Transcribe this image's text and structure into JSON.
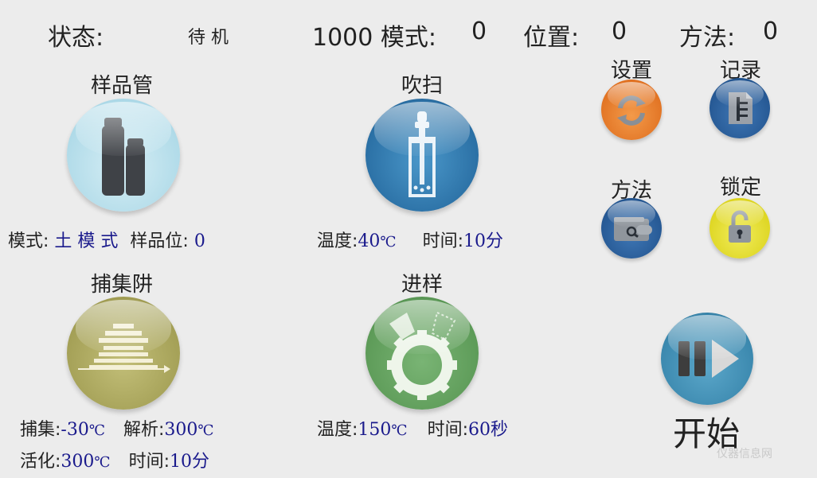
{
  "status_bar": {
    "state_label": "状态:",
    "state_value": "待 机",
    "mode_label": "1000 模式:",
    "mode_value": "0",
    "position_label": "位置:",
    "position_value": "0",
    "method_label": "方法:",
    "method_value": "0"
  },
  "sample_tube": {
    "title": "样品管",
    "mode_label": "模式:",
    "mode_value": "土 模 式",
    "pos_label": "样品位:",
    "pos_value": "0"
  },
  "purge": {
    "title": "吹扫",
    "temp_label": "温度:",
    "temp_value": "40",
    "temp_unit": "℃",
    "time_label": "时间:",
    "time_value": "10",
    "time_unit": "分"
  },
  "trap": {
    "title": "捕集阱",
    "trap_label": "捕集:",
    "trap_value": "-30",
    "trap_unit": "℃",
    "desorb_label": "解析:",
    "desorb_value": "300",
    "desorb_unit": "℃",
    "activate_label": "活化:",
    "activate_value": "300",
    "activate_unit": "℃",
    "time_label": "时间:",
    "time_value": "10",
    "time_unit": "分"
  },
  "injection": {
    "title": "进样",
    "temp_label": "温度:",
    "temp_value": "150",
    "temp_unit": "℃",
    "time_label": "时间:",
    "time_value": "60",
    "time_unit": "秒"
  },
  "side_buttons": {
    "settings": "设置",
    "records": "记录",
    "method": "方法",
    "lock": "锁定"
  },
  "start": {
    "label": "开始"
  },
  "watermark": {
    "text": "仪器信息网"
  },
  "colors": {
    "sample_orb": "#bfe3ee",
    "purge_orb": "#2f7bb0",
    "trap_orb": "#a8a45a",
    "injection_orb": "#5f9e5a",
    "settings_orb": "#e87a24",
    "records_orb": "#245a9a",
    "method_orb": "#245a9a",
    "lock_orb": "#e8e02a",
    "start_orb": "#3d8fb5",
    "value_text": "#1a1a8c"
  },
  "icons": {
    "sample_tube": "sample-bottles-icon",
    "purge": "dropper-vial-icon",
    "trap": "trap-stack-icon",
    "injection": "valve-gear-icon",
    "settings": "refresh-icon",
    "records": "document-icon",
    "method": "wallet-icon",
    "lock": "unlocked-padlock-icon",
    "start": "pause-play-icon"
  }
}
